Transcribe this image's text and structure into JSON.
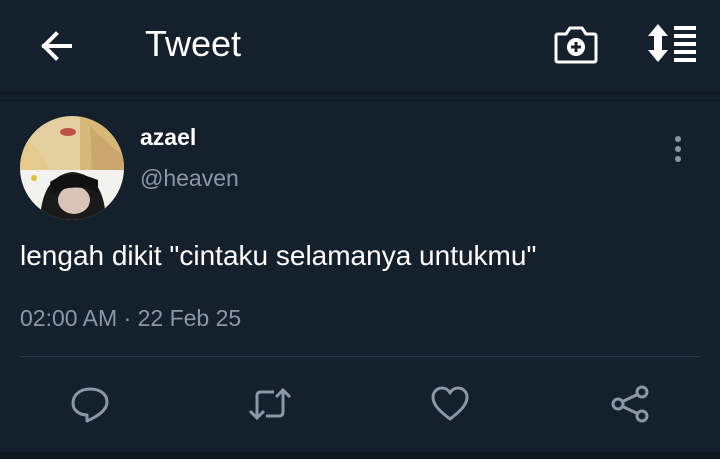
{
  "header": {
    "title": "Tweet",
    "icons": [
      "back-arrow-icon",
      "camera-plus-icon",
      "sort-list-icon"
    ]
  },
  "tweet": {
    "author_name": "azael",
    "author_handle": "@heaven",
    "text": "lengah dikit \"cintaku selamanya untukmu\"",
    "timestamp": "02:00 AM · 22 Feb 25"
  },
  "actions": [
    "reply-icon",
    "retweet-icon",
    "like-icon",
    "share-icon"
  ],
  "colors": {
    "background": "#14202b",
    "text_primary": "#ffffff",
    "text_secondary": "#8899a6",
    "icon_muted": "#8899a6",
    "divider": "#2a3a48"
  }
}
